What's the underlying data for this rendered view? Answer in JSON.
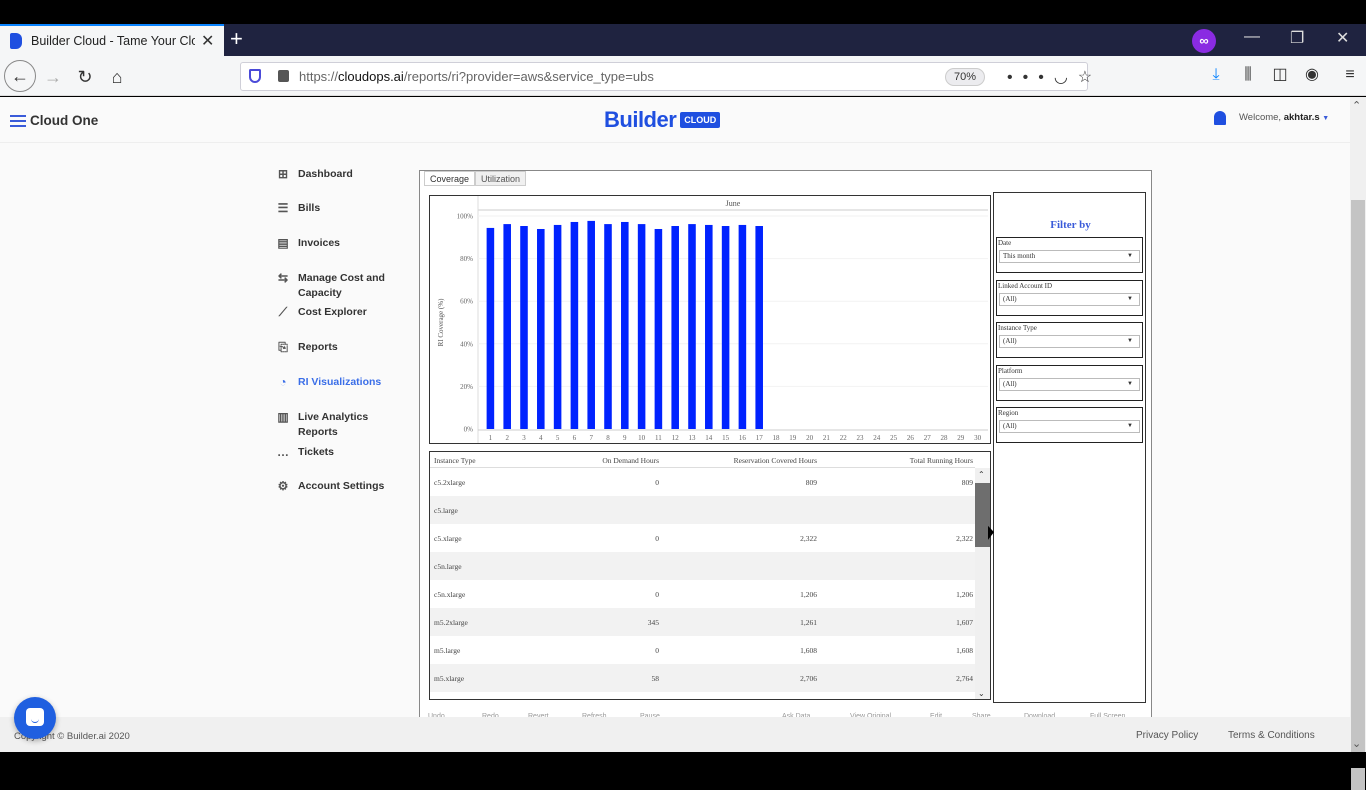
{
  "browser": {
    "tab_title": "Builder Cloud - Tame Your Clou",
    "new_tab_label": "+",
    "url_prefix": "https://",
    "url_domain": "cloudops.ai",
    "url_path": "/reports/ri?provider=aws&service_type=ubs",
    "zoom_level": "70%"
  },
  "header": {
    "app_name": "Cloud One",
    "logo_text": "Builder",
    "logo_badge": "CLOUD",
    "welcome_prefix": "Welcome, ",
    "username": "akhtar.s"
  },
  "sidebar": {
    "items": [
      {
        "label": "Dashboard",
        "icon": "grid-icon",
        "glyph": "⊞",
        "active": false
      },
      {
        "label": "Bills",
        "icon": "list-icon",
        "glyph": "☰",
        "active": false
      },
      {
        "label": "Invoices",
        "icon": "invoice-icon",
        "glyph": "▤",
        "active": false
      },
      {
        "label": "Manage Cost and Capacity",
        "icon": "arrows-icon",
        "glyph": "⇆",
        "active": false
      },
      {
        "label": "Cost Explorer",
        "icon": "trend-icon",
        "glyph": "⟋",
        "active": false
      },
      {
        "label": "Reports",
        "icon": "report-search-icon",
        "glyph": "⎘",
        "active": false
      },
      {
        "label": "RI Visualizations",
        "icon": "pie-chart-icon",
        "glyph": "◔",
        "active": true
      },
      {
        "label": "Live Analytics Reports",
        "icon": "bar-chart-icon",
        "glyph": "▥",
        "active": false
      },
      {
        "label": "Tickets",
        "icon": "chat-bubble-icon",
        "glyph": "…",
        "active": false
      },
      {
        "label": "Account Settings",
        "icon": "gear-icon",
        "glyph": "⚙",
        "active": false
      }
    ]
  },
  "viz": {
    "tabs": [
      {
        "label": "Coverage",
        "active": true
      },
      {
        "label": "Utilization",
        "active": false
      }
    ],
    "filter": {
      "title": "Filter by",
      "groups": [
        {
          "label": "Date",
          "value": "This month"
        },
        {
          "label": "Linked Account ID",
          "value": "(All)"
        },
        {
          "label": "Instance Type",
          "value": "(All)"
        },
        {
          "label": "Platform",
          "value": "(All)"
        },
        {
          "label": "Region",
          "value": "(All)"
        }
      ]
    },
    "table": {
      "columns": [
        "Instance Type",
        "On Demand Hours",
        "Reservation Covered Hours",
        "Total Running Hours"
      ],
      "rows": [
        [
          "c5.2xlarge",
          "0",
          "809",
          "809"
        ],
        [
          "c5.large",
          "",
          "",
          ""
        ],
        [
          "c5.xlarge",
          "0",
          "2,322",
          "2,322"
        ],
        [
          "c5n.large",
          "",
          "",
          ""
        ],
        [
          "c5n.xlarge",
          "0",
          "1,206",
          "1,206"
        ],
        [
          "m5.2xlarge",
          "345",
          "1,261",
          "1,607"
        ],
        [
          "m5.large",
          "0",
          "1,608",
          "1,608"
        ],
        [
          "m5.xlarge",
          "58",
          "2,706",
          "2,764"
        ]
      ]
    },
    "toolbar": [
      "Undo",
      "Redo",
      "Revert",
      "Refresh",
      "Pause",
      "Ask Data",
      "View Original",
      "Edit",
      "Share",
      "Download",
      "Full Screen"
    ]
  },
  "chart_data": {
    "type": "bar",
    "title": "June",
    "xlabel": "",
    "ylabel": "RI Coverage (%)",
    "ylim": [
      0,
      100
    ],
    "yticks": [
      "0%",
      "20%",
      "40%",
      "60%",
      "80%",
      "100%"
    ],
    "categories": [
      "1",
      "2",
      "3",
      "4",
      "5",
      "6",
      "7",
      "8",
      "9",
      "10",
      "11",
      "12",
      "13",
      "14",
      "15",
      "16",
      "17",
      "18",
      "19",
      "20",
      "21",
      "22",
      "23",
      "24",
      "25",
      "26",
      "27",
      "28",
      "29",
      "30"
    ],
    "values": [
      94.4,
      96.2,
      95.3,
      93.9,
      95.8,
      97.2,
      97.7,
      96.2,
      97.2,
      96.2,
      93.9,
      95.3,
      96.2,
      95.8,
      95.3,
      95.8,
      95.3,
      null,
      null,
      null,
      null,
      null,
      null,
      null,
      null,
      null,
      null,
      null,
      null,
      null
    ],
    "bar_color": "#0022ff",
    "grid": false
  },
  "footer": {
    "copyright": "Copyright © Builder.ai 2020",
    "privacy": "Privacy Policy",
    "terms": "Terms & Conditions"
  }
}
